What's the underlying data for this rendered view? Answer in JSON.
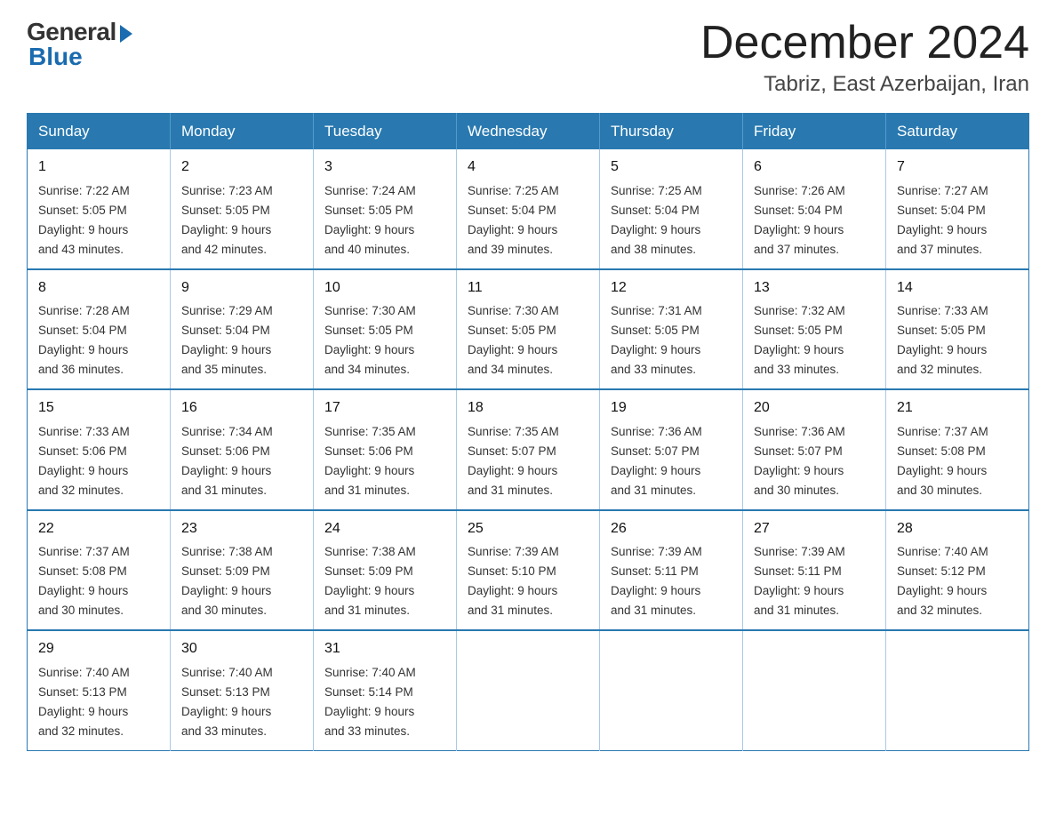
{
  "logo": {
    "general": "General",
    "blue": "Blue"
  },
  "header": {
    "month": "December 2024",
    "location": "Tabriz, East Azerbaijan, Iran"
  },
  "weekdays": [
    "Sunday",
    "Monday",
    "Tuesday",
    "Wednesday",
    "Thursday",
    "Friday",
    "Saturday"
  ],
  "weeks": [
    [
      {
        "day": "1",
        "sunrise": "7:22 AM",
        "sunset": "5:05 PM",
        "daylight": "9 hours and 43 minutes."
      },
      {
        "day": "2",
        "sunrise": "7:23 AM",
        "sunset": "5:05 PM",
        "daylight": "9 hours and 42 minutes."
      },
      {
        "day": "3",
        "sunrise": "7:24 AM",
        "sunset": "5:05 PM",
        "daylight": "9 hours and 40 minutes."
      },
      {
        "day": "4",
        "sunrise": "7:25 AM",
        "sunset": "5:04 PM",
        "daylight": "9 hours and 39 minutes."
      },
      {
        "day": "5",
        "sunrise": "7:25 AM",
        "sunset": "5:04 PM",
        "daylight": "9 hours and 38 minutes."
      },
      {
        "day": "6",
        "sunrise": "7:26 AM",
        "sunset": "5:04 PM",
        "daylight": "9 hours and 37 minutes."
      },
      {
        "day": "7",
        "sunrise": "7:27 AM",
        "sunset": "5:04 PM",
        "daylight": "9 hours and 37 minutes."
      }
    ],
    [
      {
        "day": "8",
        "sunrise": "7:28 AM",
        "sunset": "5:04 PM",
        "daylight": "9 hours and 36 minutes."
      },
      {
        "day": "9",
        "sunrise": "7:29 AM",
        "sunset": "5:04 PM",
        "daylight": "9 hours and 35 minutes."
      },
      {
        "day": "10",
        "sunrise": "7:30 AM",
        "sunset": "5:05 PM",
        "daylight": "9 hours and 34 minutes."
      },
      {
        "day": "11",
        "sunrise": "7:30 AM",
        "sunset": "5:05 PM",
        "daylight": "9 hours and 34 minutes."
      },
      {
        "day": "12",
        "sunrise": "7:31 AM",
        "sunset": "5:05 PM",
        "daylight": "9 hours and 33 minutes."
      },
      {
        "day": "13",
        "sunrise": "7:32 AM",
        "sunset": "5:05 PM",
        "daylight": "9 hours and 33 minutes."
      },
      {
        "day": "14",
        "sunrise": "7:33 AM",
        "sunset": "5:05 PM",
        "daylight": "9 hours and 32 minutes."
      }
    ],
    [
      {
        "day": "15",
        "sunrise": "7:33 AM",
        "sunset": "5:06 PM",
        "daylight": "9 hours and 32 minutes."
      },
      {
        "day": "16",
        "sunrise": "7:34 AM",
        "sunset": "5:06 PM",
        "daylight": "9 hours and 31 minutes."
      },
      {
        "day": "17",
        "sunrise": "7:35 AM",
        "sunset": "5:06 PM",
        "daylight": "9 hours and 31 minutes."
      },
      {
        "day": "18",
        "sunrise": "7:35 AM",
        "sunset": "5:07 PM",
        "daylight": "9 hours and 31 minutes."
      },
      {
        "day": "19",
        "sunrise": "7:36 AM",
        "sunset": "5:07 PM",
        "daylight": "9 hours and 31 minutes."
      },
      {
        "day": "20",
        "sunrise": "7:36 AM",
        "sunset": "5:07 PM",
        "daylight": "9 hours and 30 minutes."
      },
      {
        "day": "21",
        "sunrise": "7:37 AM",
        "sunset": "5:08 PM",
        "daylight": "9 hours and 30 minutes."
      }
    ],
    [
      {
        "day": "22",
        "sunrise": "7:37 AM",
        "sunset": "5:08 PM",
        "daylight": "9 hours and 30 minutes."
      },
      {
        "day": "23",
        "sunrise": "7:38 AM",
        "sunset": "5:09 PM",
        "daylight": "9 hours and 30 minutes."
      },
      {
        "day": "24",
        "sunrise": "7:38 AM",
        "sunset": "5:09 PM",
        "daylight": "9 hours and 31 minutes."
      },
      {
        "day": "25",
        "sunrise": "7:39 AM",
        "sunset": "5:10 PM",
        "daylight": "9 hours and 31 minutes."
      },
      {
        "day": "26",
        "sunrise": "7:39 AM",
        "sunset": "5:11 PM",
        "daylight": "9 hours and 31 minutes."
      },
      {
        "day": "27",
        "sunrise": "7:39 AM",
        "sunset": "5:11 PM",
        "daylight": "9 hours and 31 minutes."
      },
      {
        "day": "28",
        "sunrise": "7:40 AM",
        "sunset": "5:12 PM",
        "daylight": "9 hours and 32 minutes."
      }
    ],
    [
      {
        "day": "29",
        "sunrise": "7:40 AM",
        "sunset": "5:13 PM",
        "daylight": "9 hours and 32 minutes."
      },
      {
        "day": "30",
        "sunrise": "7:40 AM",
        "sunset": "5:13 PM",
        "daylight": "9 hours and 33 minutes."
      },
      {
        "day": "31",
        "sunrise": "7:40 AM",
        "sunset": "5:14 PM",
        "daylight": "9 hours and 33 minutes."
      },
      null,
      null,
      null,
      null
    ]
  ],
  "labels": {
    "sunrise": "Sunrise:",
    "sunset": "Sunset:",
    "daylight": "Daylight:"
  }
}
